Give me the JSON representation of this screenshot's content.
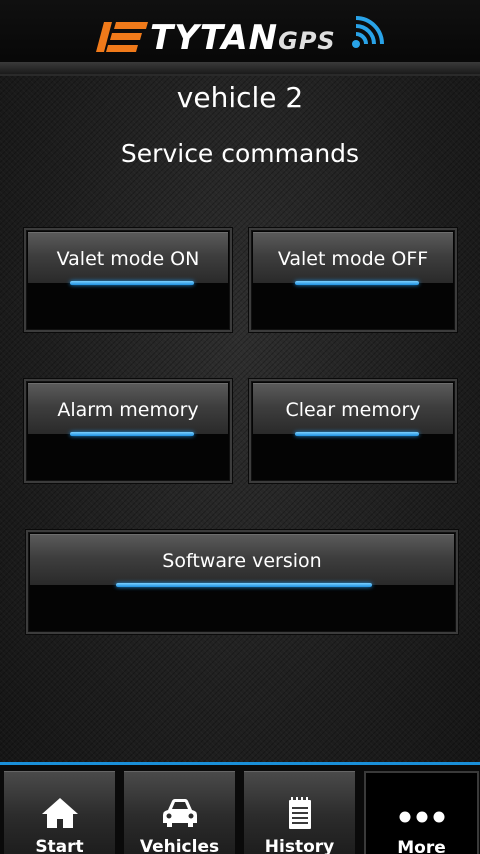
{
  "header": {
    "logo_text": "TYTAN",
    "logo_suffix": "GPS"
  },
  "vehicle_name": "vehicle 2",
  "section_title": "Service commands",
  "commands": {
    "valet_on": "Valet mode ON",
    "valet_off": "Valet mode OFF",
    "alarm_memory": "Alarm memory",
    "clear_memory": "Clear memory",
    "software_version": "Software version"
  },
  "nav": {
    "start": "Start",
    "vehicles": "Vehicles",
    "history": "History",
    "more": "More",
    "active": "more"
  },
  "colors": {
    "accent": "#1a8fd8",
    "brand_orange": "#f07a1a",
    "text": "#ffffff"
  }
}
